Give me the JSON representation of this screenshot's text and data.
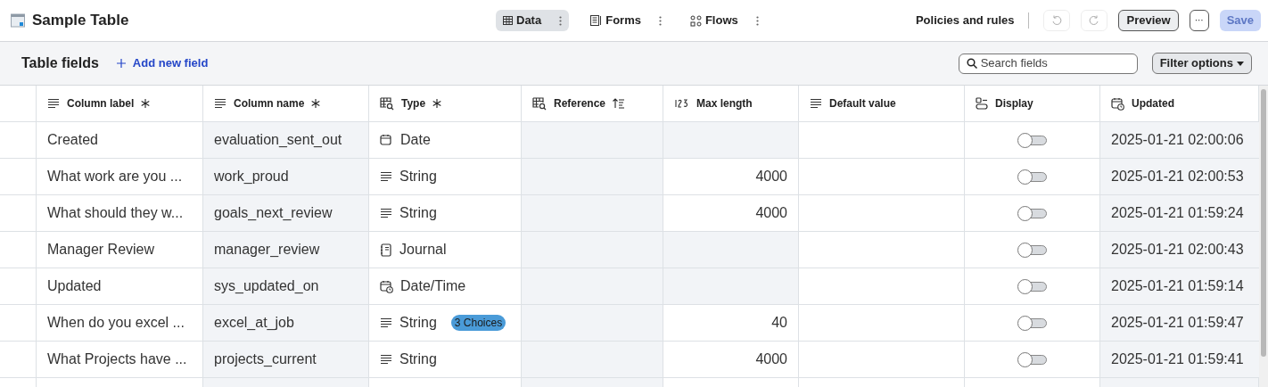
{
  "header": {
    "title": "Sample Table",
    "tabs": [
      {
        "label": "Data",
        "kind": "table",
        "selected": true
      },
      {
        "label": "Forms",
        "kind": "form",
        "selected": false
      },
      {
        "label": "Flows",
        "kind": "flow",
        "selected": false
      }
    ],
    "policies": "Policies and rules",
    "undo": {
      "disabled": true
    },
    "redo": {
      "disabled": true
    },
    "preview": "Preview",
    "more": "···",
    "save": {
      "label": "Save",
      "disabled": true
    }
  },
  "toolbar": {
    "title": "Table fields",
    "add": "Add new field",
    "search": {
      "placeholder": "Search fields"
    },
    "filter": "Filter options"
  },
  "table": {
    "columns": [
      {
        "label": "Column label",
        "kind": "text",
        "required": true
      },
      {
        "label": "Column name",
        "kind": "text",
        "required": true
      },
      {
        "label": "Type",
        "kind": "lookup",
        "required": true
      },
      {
        "label": "Reference",
        "kind": "lookup",
        "required": false,
        "sort": true
      },
      {
        "label": "Max length",
        "kind": "number",
        "required": false
      },
      {
        "label": "Default value",
        "kind": "text",
        "required": false
      },
      {
        "label": "Display",
        "kind": "display",
        "required": false
      },
      {
        "label": "Updated",
        "kind": "calendar",
        "required": false
      }
    ],
    "rows": [
      {
        "label": "Created",
        "name": "evaluation_sent_out",
        "type": "Date",
        "kind": "date",
        "max_length": "",
        "display_on": false,
        "updated": "2025-01-21 02:00:06"
      },
      {
        "label": "What work are you ...",
        "name": "work_proud",
        "type": "String",
        "kind": "string",
        "max_length": "4000",
        "display_on": false,
        "updated": "2025-01-21 02:00:53"
      },
      {
        "label": "What should they w...",
        "name": "goals_next_review",
        "type": "String",
        "kind": "string",
        "max_length": "4000",
        "display_on": false,
        "updated": "2025-01-21 01:59:24"
      },
      {
        "label": "Manager Review",
        "name": "manager_review",
        "type": "Journal",
        "kind": "journal",
        "max_length": "",
        "display_on": false,
        "updated": "2025-01-21 02:00:43"
      },
      {
        "label": "Updated",
        "name": "sys_updated_on",
        "type": "Date/Time",
        "kind": "datetime",
        "max_length": "",
        "display_on": false,
        "updated": "2025-01-21 01:59:14"
      },
      {
        "label": "When do you excel ...",
        "name": "excel_at_job",
        "type": "String",
        "kind": "string",
        "badge": "3 Choices",
        "max_length": "40",
        "display_on": false,
        "updated": "2025-01-21 01:59:47"
      },
      {
        "label": "What Projects have ...",
        "name": "projects_current",
        "type": "String",
        "kind": "string",
        "max_length": "4000",
        "display_on": false,
        "updated": "2025-01-21 01:59:41"
      }
    ]
  }
}
